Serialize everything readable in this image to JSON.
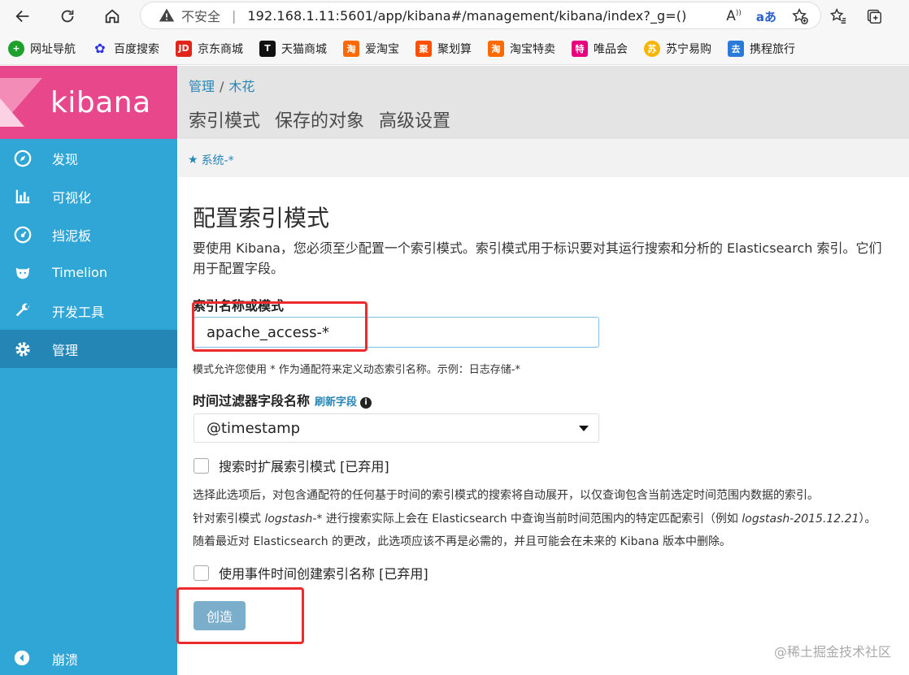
{
  "browser": {
    "insecure_label": "不安全",
    "url": "192.168.1.11:5601/app/kibana#/management/kibana/index?_g=()",
    "read_aloud_label": "A",
    "translate_label": "aあ"
  },
  "bookmarks": [
    {
      "label": "网址导航",
      "icon": "globe-icon",
      "color": "#1da12b"
    },
    {
      "label": "百度搜索",
      "icon": "paw-icon",
      "color": "#2932e1"
    },
    {
      "label": "京东商城",
      "icon": "jd-icon",
      "color": "#e1251b",
      "glyph": "JD"
    },
    {
      "label": "天猫商城",
      "icon": "tmall-icon",
      "color": "#111111",
      "glyph": "T"
    },
    {
      "label": "爱淘宝",
      "icon": "taobao-icon",
      "color": "#ff6a00",
      "glyph": "淘"
    },
    {
      "label": "聚划算",
      "icon": "juhuasuan-icon",
      "color": "#ff5000",
      "glyph": "聚"
    },
    {
      "label": "淘宝特卖",
      "icon": "tmall-sale-icon",
      "color": "#ff6a00",
      "glyph": "淘"
    },
    {
      "label": "唯品会",
      "icon": "vip-icon",
      "color": "#e6007e",
      "glyph": "特"
    },
    {
      "label": "苏宁易购",
      "icon": "suning-icon",
      "color": "#f6b500",
      "glyph": "苏"
    },
    {
      "label": "携程旅行",
      "icon": "ctrip-icon",
      "color": "#2a7ad9",
      "glyph": "去"
    }
  ],
  "sidebar": {
    "logo_text": "kibana",
    "items": [
      {
        "label": "发现",
        "icon": "compass-icon"
      },
      {
        "label": "可视化",
        "icon": "bar-chart-icon"
      },
      {
        "label": "挡泥板",
        "icon": "dashboard-icon"
      },
      {
        "label": "Timelion",
        "icon": "timelion-icon"
      },
      {
        "label": "开发工具",
        "icon": "wrench-icon"
      },
      {
        "label": "管理",
        "icon": "gear-icon",
        "active": true
      }
    ],
    "collapse_label": "崩溃"
  },
  "header": {
    "breadcrumb": [
      "管理",
      "木花"
    ],
    "tabs": [
      "索引模式",
      "保存的对象",
      "高级设置"
    ],
    "favorite": "系统-*"
  },
  "form": {
    "title": "配置索引模式",
    "description_1": "要使用 Kibana，您必须至少配置一个索引模式。索引模式用于标识要对其运行搜索和分析的 Elasticsearch 索引。它们",
    "description_2": "用于配置字段。",
    "index_label": "索引名称或模式",
    "index_value": "apache_access-*",
    "index_help": "模式允许您使用 * 作为通配符来定义动态索引名称。示例：日志存储-*",
    "time_label": "时间过滤器字段名称",
    "refresh_label": "刷新字段",
    "time_value": "@timestamp",
    "expand_label": "搜索时扩展索引模式 [已弃用]",
    "note_1": "选择此选项后，对包含通配符的任何基于时间的索引模式的搜索将自动展开，以仅查询包含当前选定时间范围内数据的索引。",
    "note_2a": "针对索引模式 ",
    "note_2b": "logstash-*",
    "note_2c": " 进行搜索实际上会在 Elasticsearch 中查询当前时间范围内的特定匹配索引（例如 ",
    "note_2d": "logstash-2015.12.21",
    "note_2e": "）。",
    "note_3": "随着最近对 Elasticsearch 的更改，此选项应该不再是必需的，并且可能会在未来的 Kibana 版本中删除。",
    "event_label": "使用事件时间创建索引名称 [已弃用]",
    "create_label": "创造"
  },
  "watermark": "@稀土掘金技术社区",
  "colors": {
    "sidebar": "#2fa6d6",
    "logo": "#e8488b",
    "active_nav": "#2386b5",
    "highlight": "#ec2c2c",
    "button": "#7aaecb"
  }
}
